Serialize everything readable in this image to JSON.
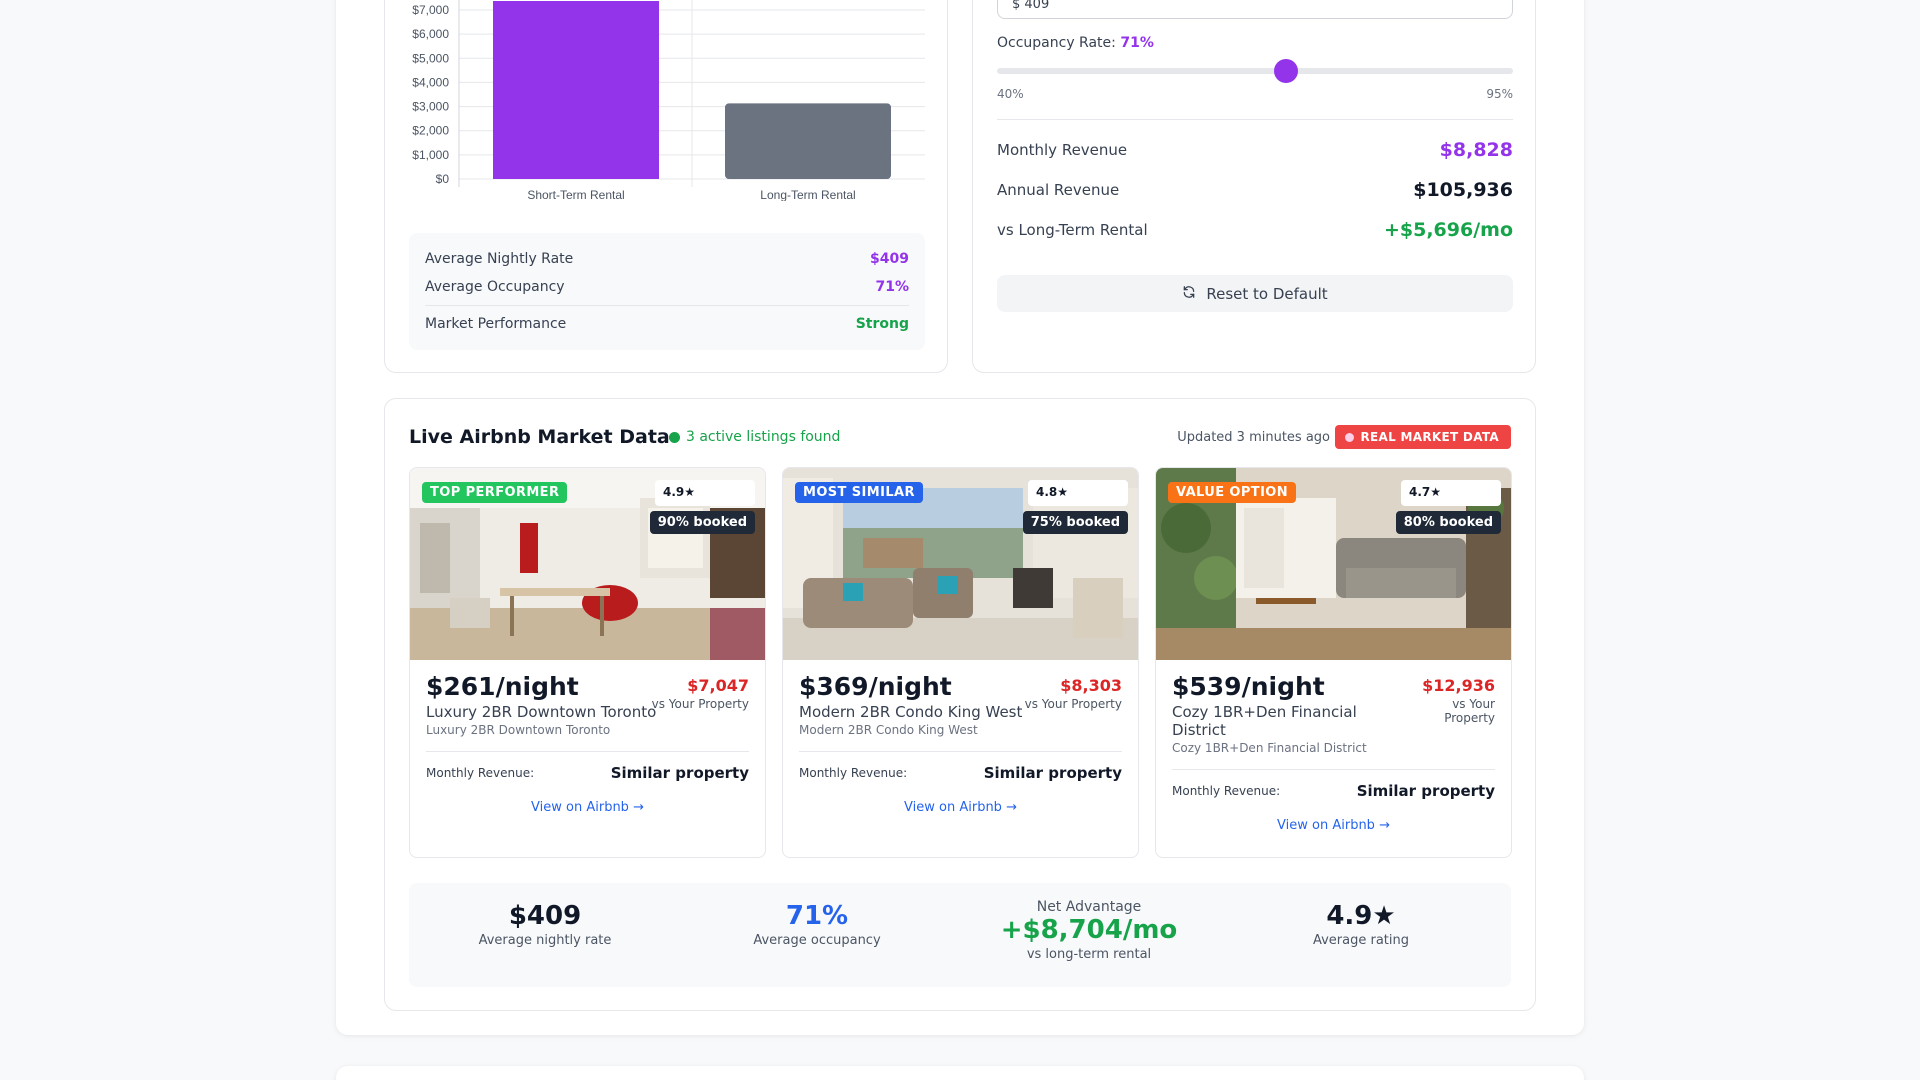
{
  "chart_data": {
    "type": "bar",
    "categories": [
      "Short-Term Rental",
      "Long-Term Rental"
    ],
    "values": [
      8828,
      3132
    ],
    "colors": [
      "#9333ea",
      "#6b7280"
    ],
    "y_ticks": [
      "$0",
      "$1,000",
      "$2,000",
      "$3,000",
      "$4,000",
      "$5,000",
      "$6,000",
      "$7,000"
    ],
    "ylim": [
      0,
      7000
    ],
    "grid": true
  },
  "chart_stats": {
    "rows": [
      {
        "label": "Average Nightly Rate",
        "value": "$409",
        "color": "#9333ea"
      },
      {
        "label": "Average Occupancy",
        "value": "71%",
        "color": "#9333ea"
      },
      {
        "label": "Market Performance",
        "value": "Strong",
        "color": "#16a34a"
      }
    ]
  },
  "calculator": {
    "nightly_input_value": "$ 409",
    "occupancy_label": "Occupancy Rate:",
    "occupancy_value": "71%",
    "occupancy_fraction": 0.56,
    "slider_min": "40%",
    "slider_max": "95%",
    "monthly_label": "Monthly Revenue",
    "monthly_value": "$8,828",
    "annual_label": "Annual Revenue",
    "annual_value": "$105,936",
    "vs_label": "vs Long-Term Rental",
    "vs_value": "+$5,696/mo",
    "reset_label": "Reset to Default",
    "accent": "#9333ea"
  },
  "market": {
    "title": "Live Airbnb Market Data",
    "active_text": "3 active listings found",
    "updated": "Updated 3 minutes ago",
    "badge": "REAL MARKET DATA",
    "listings": [
      {
        "tag": "TOP PERFORMER",
        "tag_color": "#22c55e",
        "rating": "4.9★",
        "booked": "90% booked",
        "price": "$261/night",
        "revenue": "$7,047",
        "revenue_sub": "vs Your Property",
        "name": "Luxury 2BR Downtown Toronto",
        "subname": "Luxury 2BR Downtown Toronto",
        "monthly_label": "Monthly Revenue:",
        "monthly_value": "Similar property",
        "link": "View on Airbnb →"
      },
      {
        "tag": "MOST SIMILAR",
        "tag_color": "#2563eb",
        "rating": "4.8★",
        "booked": "75% booked",
        "price": "$369/night",
        "revenue": "$8,303",
        "revenue_sub": "vs Your Property",
        "name": "Modern 2BR Condo King West",
        "subname": "Modern 2BR Condo King West",
        "monthly_label": "Monthly Revenue:",
        "monthly_value": "Similar property",
        "link": "View on Airbnb →"
      },
      {
        "tag": "VALUE OPTION",
        "tag_color": "#f97316",
        "rating": "4.7★",
        "booked": "80% booked",
        "price": "$539/night",
        "revenue": "$12,936",
        "revenue_sub": "vs Your Property",
        "name": "Cozy 1BR+Den Financial District",
        "subname": "Cozy 1BR+Den Financial District",
        "monthly_label": "Monthly Revenue:",
        "monthly_value": "Similar property",
        "link": "View on Airbnb →"
      }
    ],
    "summary": {
      "avg_rate": "$409",
      "avg_rate_label": "Average nightly rate",
      "avg_occ": "71%",
      "avg_occ_label": "Average occupancy",
      "net_title": "Net Advantage",
      "net_value": "+$8,704/mo",
      "net_label": "vs long-term rental",
      "avg_rating": "4.9★",
      "avg_rating_label": "Average rating"
    }
  }
}
